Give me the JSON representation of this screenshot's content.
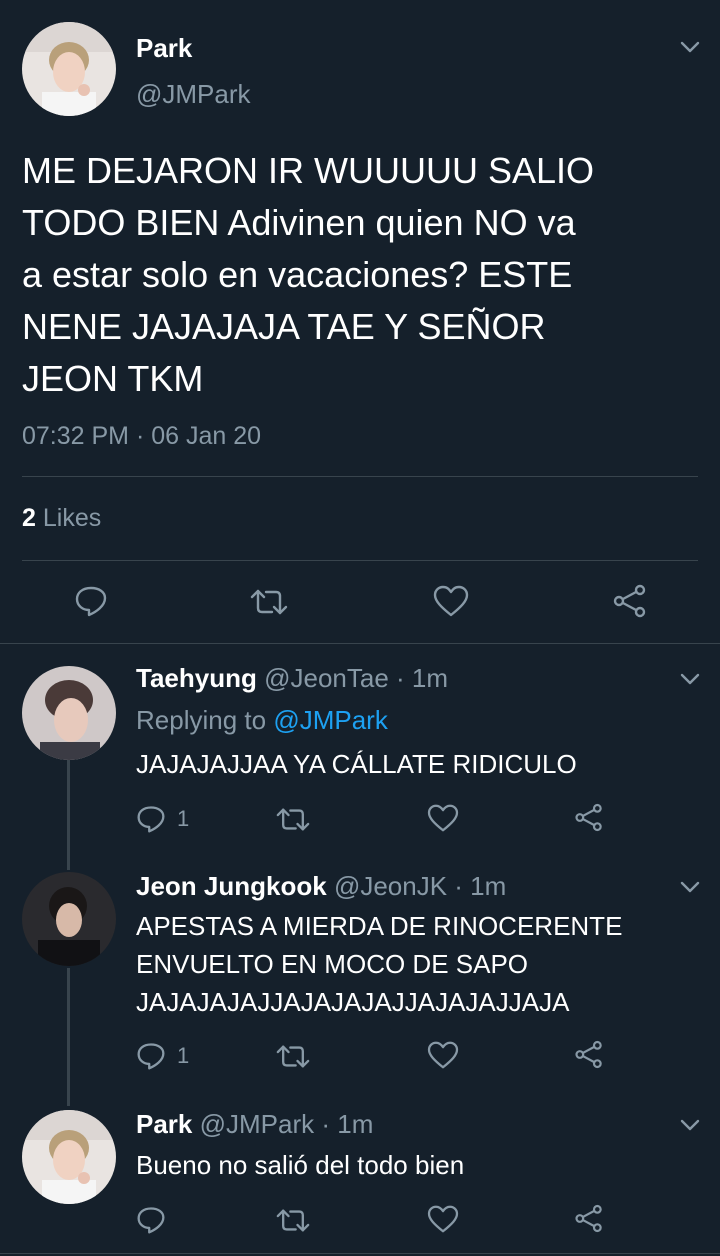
{
  "main_tweet": {
    "author_name": "Park",
    "handle": "@JMPark",
    "text_lines": [
      "ME DEJARON IR WUUUUU SALIO",
      "TODO BIEN Adivinen quien NO va",
      "a estar solo en vacaciones? ESTE",
      "NENE JAJAJAJA TAE Y SEÑOR",
      "JEON TKM"
    ],
    "timestamp": "07:32 PM · 06 Jan 20",
    "likes_count": "2",
    "likes_label": "Likes"
  },
  "replies": [
    {
      "author_name": "Taehyung",
      "handle": "@JeonTae",
      "time": "· 1m",
      "replying_prefix": "Replying to",
      "replying_handle": "@JMPark",
      "text_lines": [
        "JAJAJAJJAA YA CÁLLATE RIDICULO"
      ],
      "reply_count": "1"
    },
    {
      "author_name": "Jeon Jungkook",
      "handle": "@JeonJK",
      "time": "· 1m",
      "text_lines": [
        "APESTAS A MIERDA DE RINOCERENTE",
        "ENVUELTO EN MOCO DE SAPO",
        "JAJAJAJAJJAJAJAJAJJAJAJAJJAJA"
      ],
      "reply_count": "1"
    },
    {
      "author_name": "Park",
      "handle": "@JMPark",
      "time": "· 1m",
      "text_lines": [
        "Bueno no salió del todo bien"
      ],
      "reply_count": ""
    }
  ],
  "colors": {
    "background": "#15202b",
    "muted": "#8899a6",
    "link": "#1da1f2",
    "divider": "#38444d"
  }
}
